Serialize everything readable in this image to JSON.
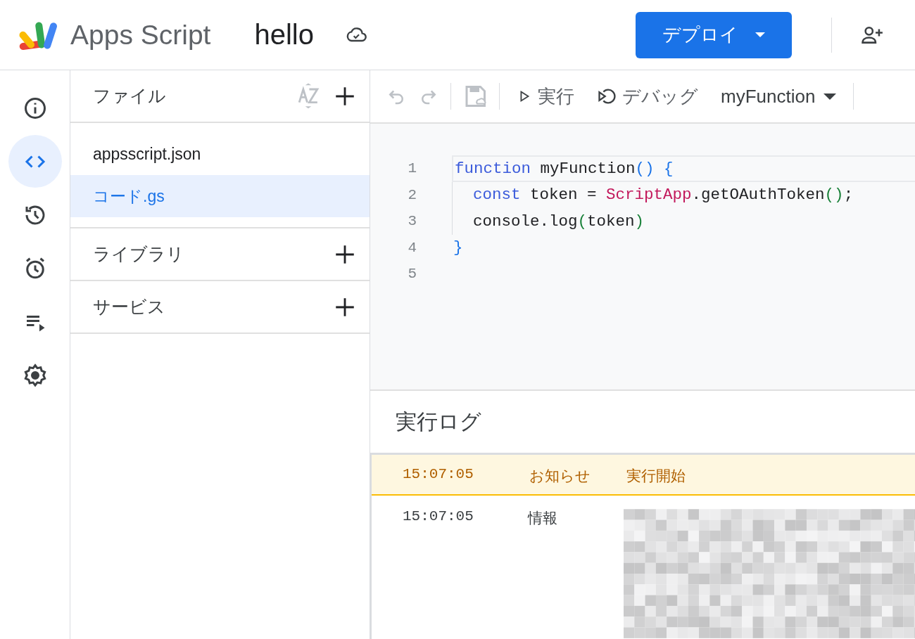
{
  "header": {
    "product": "Apps Script",
    "project": "hello",
    "deploy_button": "デプロイ"
  },
  "rail": [
    {
      "selected": false
    },
    {
      "selected": true
    },
    {
      "selected": false
    },
    {
      "selected": false
    },
    {
      "selected": false
    },
    {
      "selected": false
    }
  ],
  "files_panel": {
    "title": "ファイル",
    "files": [
      {
        "name": "appsscript.json",
        "selected": false
      },
      {
        "name": "コード.gs",
        "selected": true
      }
    ],
    "sections": [
      {
        "title": "ライブラリ"
      },
      {
        "title": "サービス"
      }
    ]
  },
  "toolbar": {
    "run": "実行",
    "debug": "デバッグ",
    "function": "myFunction"
  },
  "editor": {
    "lines": [
      {
        "number": "1",
        "indented": false,
        "tokens": [
          {
            "t": "function",
            "color": "#3b5bdb"
          },
          {
            "t": " myFunction",
            "color": "#202124"
          },
          {
            "t": "()",
            "color": "#1a73e8"
          },
          {
            "t": " {",
            "color": "#1a73e8"
          }
        ]
      },
      {
        "number": "2",
        "indented": true,
        "tokens": [
          {
            "t": "const",
            "color": "#3b5bdb"
          },
          {
            "t": " token = ",
            "color": "#202124"
          },
          {
            "t": "ScriptApp",
            "color": "#c2185b"
          },
          {
            "t": ".getOAuthToken",
            "color": "#202124"
          },
          {
            "t": "()",
            "color": "#188038"
          },
          {
            "t": ";",
            "color": "#202124"
          }
        ]
      },
      {
        "number": "3",
        "indented": true,
        "tokens": [
          {
            "t": "console.log",
            "color": "#202124"
          },
          {
            "t": "(",
            "color": "#188038"
          },
          {
            "t": "token",
            "color": "#202124"
          },
          {
            "t": ")",
            "color": "#188038"
          }
        ]
      },
      {
        "number": "4",
        "indented": false,
        "tokens": [
          {
            "t": "}",
            "color": "#1a73e8"
          }
        ]
      },
      {
        "number": "5",
        "indented": false
      }
    ]
  },
  "log": {
    "title": "実行ログ",
    "rows": [
      {
        "kind": "notice",
        "time": "15:07:05",
        "level": "お知らせ",
        "message": "実行開始",
        "redacted": false
      },
      {
        "kind": "info",
        "time": "15:07:05",
        "level": "情報",
        "redacted": true
      }
    ]
  }
}
